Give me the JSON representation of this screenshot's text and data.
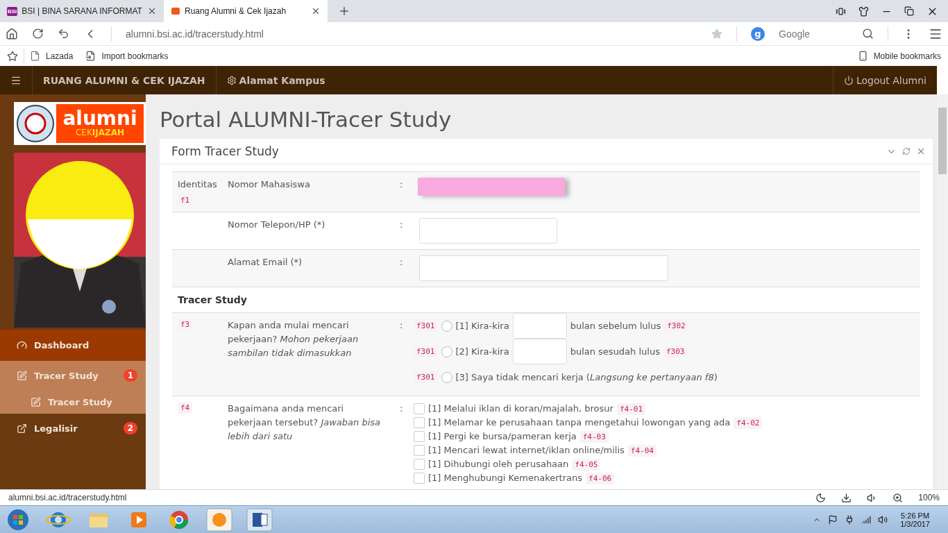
{
  "browser": {
    "tabs": [
      {
        "label": "BSI | BINA SARANA INFORMAT",
        "favicon": "BSI",
        "selected": false
      },
      {
        "label": "Ruang Alumni & Cek Ijazah",
        "selected": true
      }
    ],
    "address": "alumni.bsi.ac.id/tracerstudy.html",
    "engine_badge": "g",
    "engine": "Google",
    "bookmarks": [
      "Lazada",
      "Import bookmarks"
    ],
    "mobile_bookmarks": "Mobile bookmarks"
  },
  "navbar": {
    "brand": "RUANG ALUMNI & CEK IJAZAH",
    "link": "Alamat Kampus",
    "logout": "Logout Alumni"
  },
  "sidebar": {
    "logo": {
      "title": "alumni",
      "subtitle": "CEK**IJAZAH**"
    },
    "menu": [
      {
        "kind": "dashboard",
        "label": "Dashboard",
        "selected": true
      },
      {
        "kind": "form",
        "label": "Tracer Study",
        "badge": "1",
        "selected": false,
        "expanded": true,
        "children": [
          {
            "kind": "form",
            "label": "Tracer Study",
            "selected": false
          }
        ]
      },
      {
        "kind": "link",
        "label": "Legalisir",
        "badge": "2",
        "selected": false
      }
    ]
  },
  "page_title": "Portal ALUMNI-Tracer Study",
  "panel": {
    "title": "Form Tracer Study",
    "identity": [
      {
        "group": "Identitas",
        "code": "f1",
        "label": "Nomor Mahasiswa",
        "colon": ":",
        "kind": "redacted"
      },
      {
        "label": "Nomor Telepon/HP (*)",
        "colon": ":",
        "kind": "short"
      },
      {
        "label": "Alamat Email (*)",
        "colon": ":",
        "kind": "long"
      }
    ],
    "section": "Tracer Study",
    "questions": [
      {
        "code": "f3",
        "text": "Kapan anda mulai mencari pekerjaan? *Mohon pekerjaan sambilan tidak dimasukkan*",
        "colon": ":",
        "kind": "radio",
        "options": [
          {
            "code": "f301",
            "label": "[1] Kira-kira",
            "after": "bulan sebelum lulus",
            "after_code": "f302",
            "selected": false
          },
          {
            "code": "f301",
            "label": "[2] Kira-kira",
            "after": "bulan sesudah lulus",
            "after_code": "f303",
            "selected": false
          },
          {
            "code": "f301",
            "label": "[3] Saya tidak mencari kerja (*Langsung ke pertanyaan f8*)",
            "selected": false
          }
        ]
      },
      {
        "code": "f4",
        "text": "Bagaimana anda mencari pekerjaan tersebut? *Jawaban bisa lebih dari satu*",
        "colon": ":",
        "kind": "checkbox",
        "options": [
          {
            "label": "[1] Melalui iklan di koran/majalah, brosur",
            "code": "f4-01",
            "checked": false
          },
          {
            "label": "[1] Melamar ke perusahaan tanpa mengetahui lowongan yang ada",
            "code": "f4-02",
            "checked": false
          },
          {
            "label": "[1] Pergi ke bursa/pameran kerja",
            "code": "f4-03",
            "checked": false
          },
          {
            "label": "[1] Mencari lewat internet/iklan online/milis",
            "code": "f4-04",
            "checked": false
          },
          {
            "label": "[1] Dihubungi oleh perusahaan",
            "code": "f4-05",
            "checked": false
          },
          {
            "label": "[1] Menghubungi Kemenakertrans",
            "code": "f4-06",
            "checked": false
          }
        ]
      }
    ]
  },
  "status_bar": {
    "url": "alumni.bsi.ac.id/tracerstudy.html",
    "zoom": "100%"
  },
  "taskbar": {
    "time": "5:26 PM",
    "date": "1/3/2017"
  }
}
